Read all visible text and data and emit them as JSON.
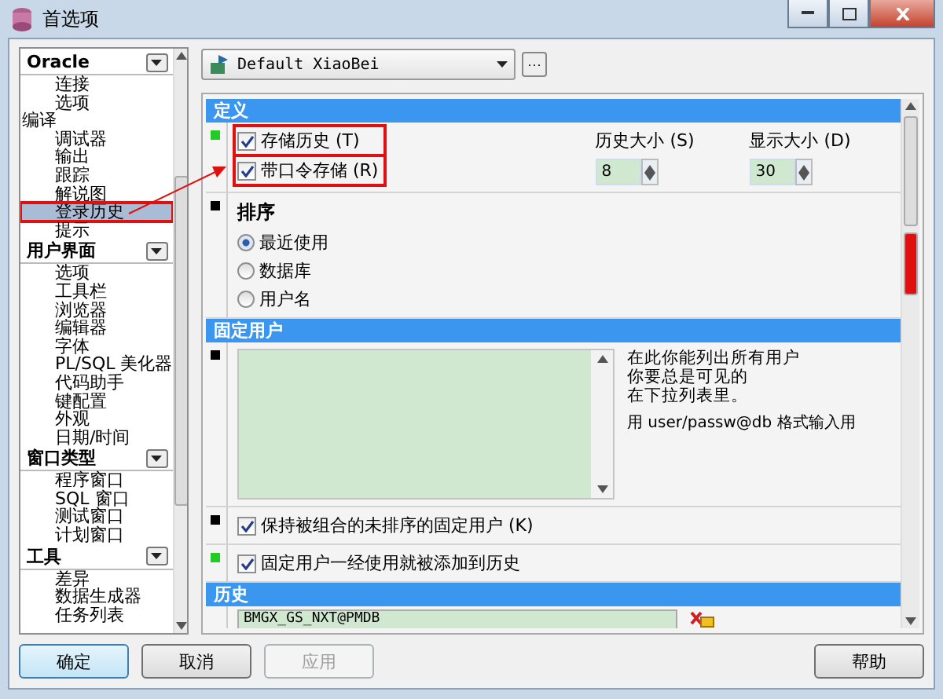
{
  "window": {
    "title": "首选项"
  },
  "sidebar": {
    "groups": [
      {
        "title": "Oracle",
        "items": [
          {
            "label": "连接",
            "kind": "page",
            "selected": false,
            "annotated": false
          },
          {
            "label": "选项",
            "kind": "page",
            "selected": false,
            "annotated": false
          },
          {
            "label": "编译",
            "kind": "category",
            "selected": false,
            "annotated": false
          },
          {
            "label": "调试器",
            "kind": "page",
            "selected": false,
            "annotated": false
          },
          {
            "label": "输出",
            "kind": "page",
            "selected": false,
            "annotated": false
          },
          {
            "label": "跟踪",
            "kind": "page",
            "selected": false,
            "annotated": false
          },
          {
            "label": "解说图",
            "kind": "page",
            "selected": false,
            "annotated": false
          },
          {
            "label": "登录历史",
            "kind": "page",
            "selected": true,
            "annotated": true
          },
          {
            "label": "提示",
            "kind": "page",
            "selected": false,
            "annotated": false
          }
        ]
      },
      {
        "title": "用户界面",
        "items": [
          {
            "label": "选项",
            "kind": "page",
            "selected": false,
            "annotated": false
          },
          {
            "label": "工具栏",
            "kind": "page",
            "selected": false,
            "annotated": false
          },
          {
            "label": "浏览器",
            "kind": "page",
            "selected": false,
            "annotated": false
          },
          {
            "label": "编辑器",
            "kind": "page",
            "selected": false,
            "annotated": false
          },
          {
            "label": "字体",
            "kind": "page",
            "selected": false,
            "annotated": false
          },
          {
            "label": "PL/SQL 美化器",
            "kind": "page",
            "selected": false,
            "annotated": false
          },
          {
            "label": "代码助手",
            "kind": "page",
            "selected": false,
            "annotated": false
          },
          {
            "label": "键配置",
            "kind": "page",
            "selected": false,
            "annotated": false
          },
          {
            "label": "外观",
            "kind": "page",
            "selected": false,
            "annotated": false
          },
          {
            "label": "日期/时间",
            "kind": "page",
            "selected": false,
            "annotated": false
          }
        ]
      },
      {
        "title": "窗口类型",
        "items": [
          {
            "label": "程序窗口",
            "kind": "page",
            "selected": false,
            "annotated": false
          },
          {
            "label": "SQL 窗口",
            "kind": "page",
            "selected": false,
            "annotated": false
          },
          {
            "label": "测试窗口",
            "kind": "page",
            "selected": false,
            "annotated": false
          },
          {
            "label": "计划窗口",
            "kind": "page",
            "selected": false,
            "annotated": false
          }
        ]
      },
      {
        "title": "工具",
        "items": [
          {
            "label": "差异",
            "kind": "page",
            "selected": false,
            "annotated": false
          },
          {
            "label": "数据生成器",
            "kind": "page",
            "selected": false,
            "annotated": false
          },
          {
            "label": "任务列表",
            "kind": "page",
            "selected": false,
            "annotated": false
          }
        ]
      }
    ]
  },
  "profile": {
    "value": "Default XiaoBei",
    "more_button": "···"
  },
  "sections": [
    {
      "title": "定义",
      "rows": [
        {
          "kind": "options",
          "color": "#22cc22",
          "checkboxes": [
            {
              "label": "存储历史 (T)",
              "checked": true,
              "annotated": true
            },
            {
              "label": "带口令存储 (R)",
              "checked": true,
              "annotated": true
            }
          ],
          "spinners": [
            {
              "label": "历史大小 (S)",
              "value": "8"
            },
            {
              "label": "显示大小 (D)",
              "value": "30"
            }
          ]
        },
        {
          "kind": "radios",
          "color": "#000000",
          "title": "排序",
          "options": [
            {
              "label": "最近使用",
              "selected": true
            },
            {
              "label": "数据库",
              "selected": false
            },
            {
              "label": "用户名",
              "selected": false
            }
          ]
        }
      ]
    },
    {
      "title": "固定用户",
      "rows": [
        {
          "kind": "list",
          "color": "#000000",
          "help": [
            "在此你能列出所有用户",
            "你要总是可见的",
            "在下拉列表里。"
          ],
          "hint": "用 user/passw@db 格式输入用"
        },
        {
          "kind": "checkbox",
          "color": "#000000",
          "label": "保持被组合的未排序的固定用户 (K)",
          "checked": true
        },
        {
          "kind": "checkbox",
          "color": "#22cc22",
          "label": "固定用户一经使用就被添加到历史",
          "checked": true
        }
      ]
    },
    {
      "title": "历史",
      "rows": [
        {
          "kind": "history",
          "entries": [
            "BMGX_GS_NXT@PMDB"
          ]
        }
      ]
    }
  ],
  "buttons": [
    {
      "label": "确定",
      "kind": "default",
      "disabled": false
    },
    {
      "label": "取消",
      "kind": "normal",
      "disabled": false
    },
    {
      "label": "应用",
      "kind": "normal",
      "disabled": true
    },
    {
      "label": "帮助",
      "kind": "help",
      "disabled": false
    }
  ]
}
